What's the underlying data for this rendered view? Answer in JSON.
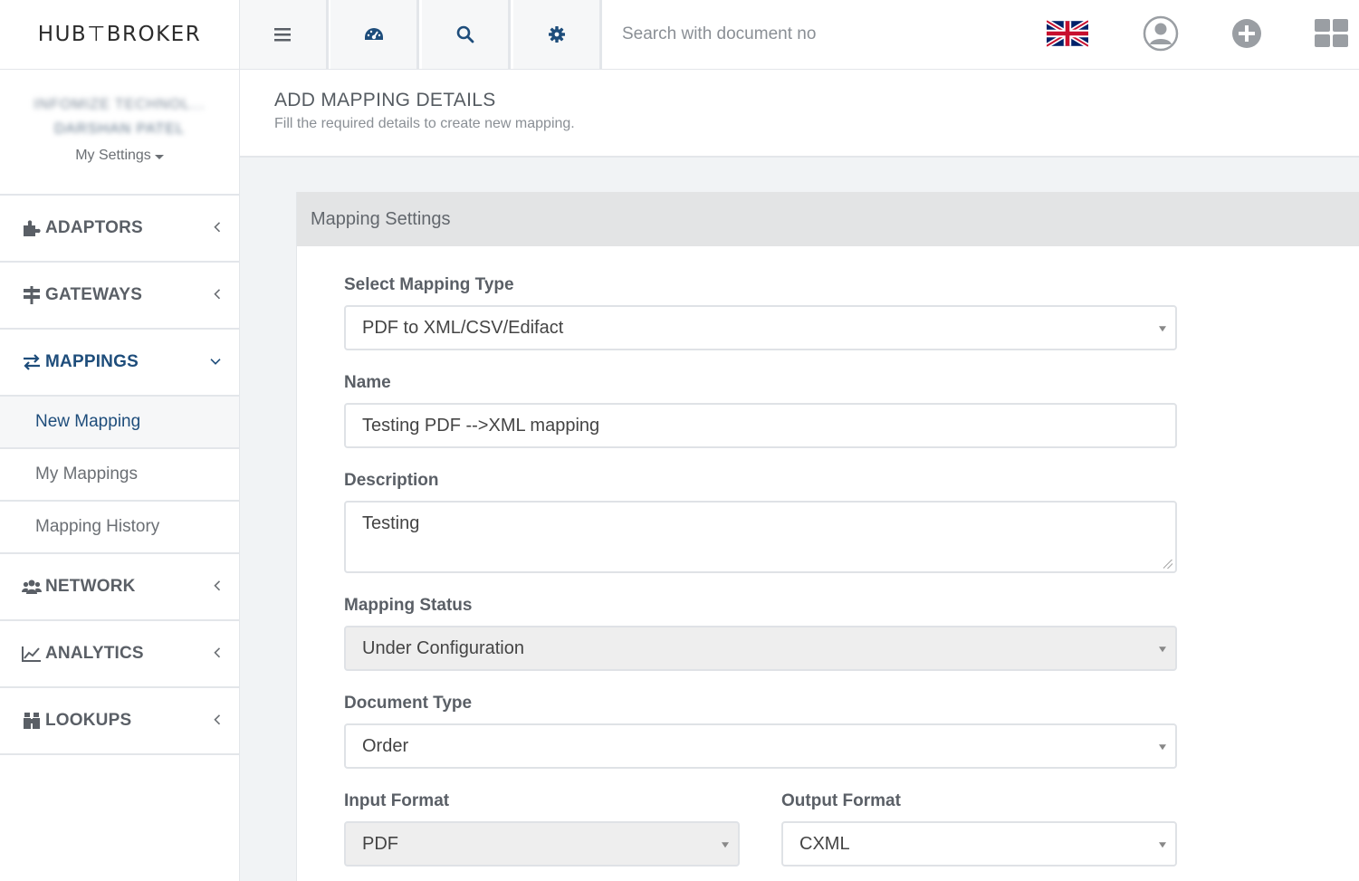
{
  "brand": {
    "name": "HUB⊤BROKER",
    "logo_icon": "hubtbroker-logo"
  },
  "topbar": {
    "buttons": [
      {
        "name": "menu-icon"
      },
      {
        "name": "dashboard-icon"
      },
      {
        "name": "search-icon"
      },
      {
        "name": "gear-icon"
      }
    ],
    "search_placeholder": "Search with document no",
    "right_icons": [
      "uk-flag-icon",
      "user-avatar-icon",
      "add-circle-icon",
      "grid-apps-icon"
    ]
  },
  "sidebar": {
    "profile": {
      "line1": "INFOMIZE TECHNOL...",
      "line2": "DARSHAN PATEL",
      "settings_label": "My Settings"
    },
    "items": [
      {
        "label": "ADAPTORS",
        "icon": "puzzle-icon"
      },
      {
        "label": "GATEWAYS",
        "icon": "signpost-icon"
      },
      {
        "label": "MAPPINGS",
        "icon": "exchange-icon",
        "expanded": true,
        "children": [
          "New Mapping",
          "My Mappings",
          "Mapping History"
        ],
        "active_child": "New Mapping"
      },
      {
        "label": "NETWORK",
        "icon": "users-icon"
      },
      {
        "label": "ANALYTICS",
        "icon": "line-chart-icon"
      },
      {
        "label": "LOOKUPS",
        "icon": "binoculars-icon"
      }
    ]
  },
  "page": {
    "title": "ADD MAPPING DETAILS",
    "subtitle": "Fill the required details to create new mapping."
  },
  "form": {
    "panel_title": "Mapping Settings",
    "mapping_type": {
      "label": "Select Mapping Type",
      "value": "PDF to XML/CSV/Edifact"
    },
    "name": {
      "label": "Name",
      "value": "Testing PDF -->XML mapping"
    },
    "description": {
      "label": "Description",
      "value": "Testing"
    },
    "status": {
      "label": "Mapping Status",
      "value": "Under Configuration"
    },
    "document_type": {
      "label": "Document Type",
      "value": "Order"
    },
    "input_format": {
      "label": "Input Format",
      "value": "PDF"
    },
    "output_format": {
      "label": "Output Format",
      "value": "CXML"
    }
  },
  "colors": {
    "accent": "#1e4d7b",
    "border": "#e3e6ea",
    "panel_head": "#e3e4e5"
  }
}
